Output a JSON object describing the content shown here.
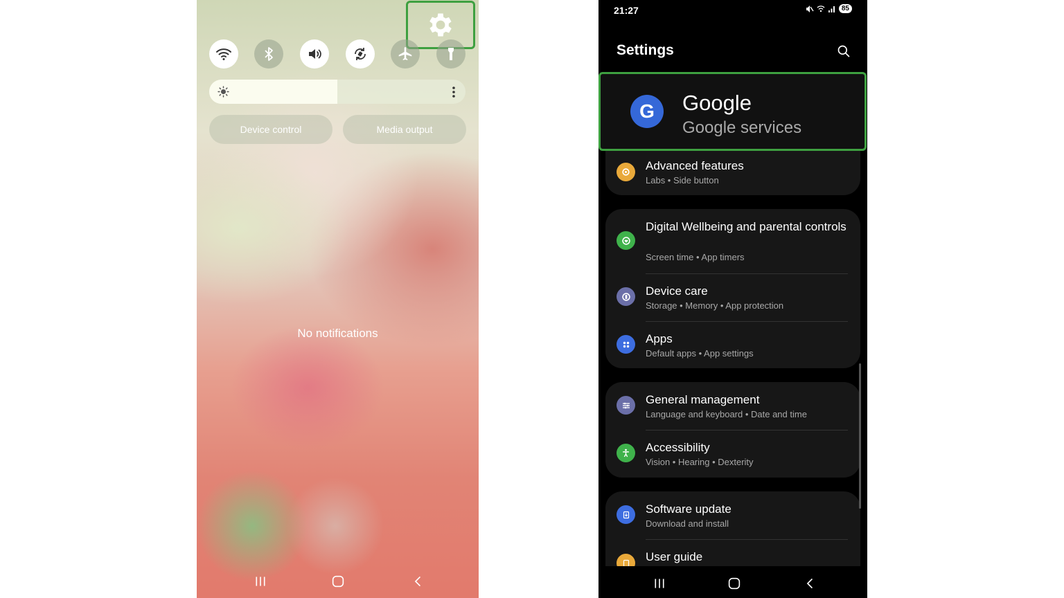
{
  "left_phone": {
    "quick_settings": [
      {
        "icon": "wifi-icon",
        "state": "on"
      },
      {
        "icon": "bluetooth-icon",
        "state": "off"
      },
      {
        "icon": "sound-icon",
        "state": "on"
      },
      {
        "icon": "auto-rotate-icon",
        "state": "on"
      },
      {
        "icon": "airplane-mode-icon",
        "state": "off"
      },
      {
        "icon": "flashlight-icon",
        "state": "off"
      }
    ],
    "settings_icon": "gear-icon",
    "brightness_level": 0.5,
    "device_control_label": "Device control",
    "media_output_label": "Media output",
    "empty_state": "No notifications",
    "highlight_color": "#3ea040"
  },
  "right_phone": {
    "status": {
      "time": "21:27",
      "battery": "85"
    },
    "title": "Settings",
    "google": {
      "icon_letter": "G",
      "title": "Google",
      "subtitle": "Google services"
    },
    "items": [
      {
        "title": "Advanced features",
        "subtitle": "Labs  •  Side button",
        "icon_color": "#e9a93a"
      },
      {
        "title": "Digital Wellbeing and parental controls",
        "subtitle": "Screen time  •  App timers",
        "icon_color": "#3fb24b"
      },
      {
        "title": "Device care",
        "subtitle": "Storage  •  Memory  •  App protection",
        "icon_color": "#6b6fa8"
      },
      {
        "title": "Apps",
        "subtitle": "Default apps  •  App settings",
        "icon_color": "#3d6de0"
      },
      {
        "title": "General management",
        "subtitle": "Language and keyboard  •  Date and time",
        "icon_color": "#6b6fa8"
      },
      {
        "title": "Accessibility",
        "subtitle": "Vision  •  Hearing  •  Dexterity",
        "icon_color": "#3fb24b"
      },
      {
        "title": "Software update",
        "subtitle": "Download and install",
        "icon_color": "#3d6de0"
      },
      {
        "title": "User guide",
        "subtitle": "",
        "icon_color": "#e9a93a"
      }
    ]
  }
}
